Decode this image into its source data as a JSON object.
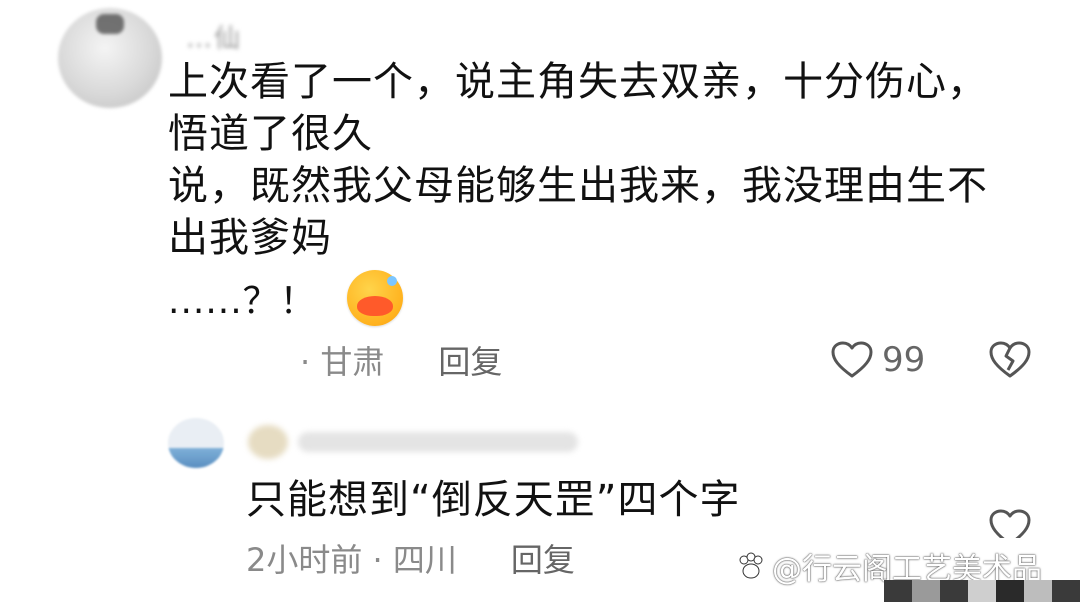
{
  "comment": {
    "username": "…仙",
    "text": "上次看了一个，说主角失去双亲，十分伤心，\n悟道了很久\n说，既然我父母能够生出我来，我没理由生不\n出我爹妈",
    "ending": "......？！",
    "emoji": "grinning-face-emoji",
    "location": "· 甘肃",
    "reply_label": "回复",
    "like_count": "99"
  },
  "reply": {
    "text": "只能想到“倒反天罡”四个字",
    "time_location": "2小时前 · 四川",
    "reply_label": "回复"
  },
  "watermark": {
    "text": "@行云阁工艺美术品"
  },
  "colors": {
    "text_primary": "#111111",
    "text_meta": "#8a8a8a",
    "icon_stroke": "#555555"
  }
}
